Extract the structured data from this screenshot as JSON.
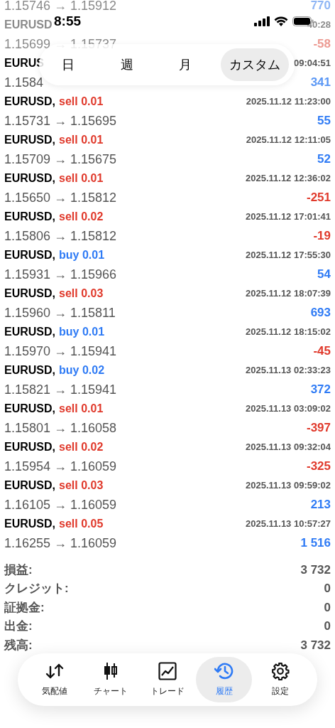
{
  "status_bar": {
    "time": "8:55"
  },
  "period_tabs": [
    {
      "label": "日",
      "selected": false
    },
    {
      "label": "週",
      "selected": false
    },
    {
      "label": "月",
      "selected": false
    },
    {
      "label": "カスタム",
      "selected": true
    }
  ],
  "trades": [
    {
      "faded": true,
      "prices": "1.15746 → 1.15912",
      "profit": {
        "text": "770",
        "color": "#8fb6f5"
      }
    },
    {
      "faded": true,
      "symbol": "EURUSD",
      "time": "40:28",
      "prices": "1.15699 → 1.15737",
      "profit": {
        "text": "-58",
        "color": "#ec9a92"
      }
    },
    {
      "faded": false,
      "symbol": "EURUS",
      "time": "09:04:51",
      "prices": "1.1584",
      "profit": {
        "text": "341",
        "color": "#5a97f5"
      }
    },
    {
      "symbol": "EURUSD,",
      "order": {
        "text": "sell 0.01",
        "color": "#e0392b"
      },
      "time": "2025.11.12 11:23:00",
      "prices": "1.15731 → 1.15695",
      "profit": {
        "text": "55",
        "color": "#2f7bf5"
      }
    },
    {
      "symbol": "EURUSD,",
      "order": {
        "text": "sell 0.01",
        "color": "#e0392b"
      },
      "time": "2025.11.12 12:11:05",
      "prices": "1.15709 → 1.15675",
      "profit": {
        "text": "52",
        "color": "#2f7bf5"
      }
    },
    {
      "symbol": "EURUSD,",
      "order": {
        "text": "sell 0.01",
        "color": "#e0392b"
      },
      "time": "2025.11.12 12:36:02",
      "prices": "1.15650 → 1.15812",
      "profit": {
        "text": "-251",
        "color": "#e0392b"
      }
    },
    {
      "symbol": "EURUSD,",
      "order": {
        "text": "sell 0.02",
        "color": "#e0392b"
      },
      "time": "2025.11.12 17:01:41",
      "prices": "1.15806 → 1.15812",
      "profit": {
        "text": "-19",
        "color": "#e0392b"
      }
    },
    {
      "symbol": "EURUSD,",
      "order": {
        "text": "buy 0.01",
        "color": "#2f7bf5"
      },
      "time": "2025.11.12 17:55:30",
      "prices": "1.15931 → 1.15966",
      "profit": {
        "text": "54",
        "color": "#2f7bf5"
      }
    },
    {
      "symbol": "EURUSD,",
      "order": {
        "text": "sell 0.03",
        "color": "#e0392b"
      },
      "time": "2025.11.12 18:07:39",
      "prices": "1.15960 → 1.15811",
      "profit": {
        "text": "693",
        "color": "#2f7bf5"
      }
    },
    {
      "symbol": "EURUSD,",
      "order": {
        "text": "buy 0.01",
        "color": "#2f7bf5"
      },
      "time": "2025.11.12 18:15:02",
      "prices": "1.15970 → 1.15941",
      "profit": {
        "text": "-45",
        "color": "#e0392b"
      }
    },
    {
      "symbol": "EURUSD,",
      "order": {
        "text": "buy 0.02",
        "color": "#2f7bf5"
      },
      "time": "2025.11.13 02:33:23",
      "prices": "1.15821 → 1.15941",
      "profit": {
        "text": "372",
        "color": "#2f7bf5"
      }
    },
    {
      "symbol": "EURUSD,",
      "order": {
        "text": "sell 0.01",
        "color": "#e0392b"
      },
      "time": "2025.11.13 03:09:02",
      "prices": "1.15801 → 1.16058",
      "profit": {
        "text": "-397",
        "color": "#e0392b"
      }
    },
    {
      "symbol": "EURUSD,",
      "order": {
        "text": "sell 0.02",
        "color": "#e0392b"
      },
      "time": "2025.11.13 09:32:04",
      "prices": "1.15954 → 1.16059",
      "profit": {
        "text": "-325",
        "color": "#e0392b"
      }
    },
    {
      "symbol": "EURUSD,",
      "order": {
        "text": "sell 0.03",
        "color": "#e0392b"
      },
      "time": "2025.11.13 09:59:02",
      "prices": "1.16105 → 1.16059",
      "profit": {
        "text": "213",
        "color": "#2f7bf5"
      }
    },
    {
      "symbol": "EURUSD,",
      "order": {
        "text": "sell 0.05",
        "color": "#e0392b"
      },
      "time": "2025.11.13 10:57:27",
      "prices": "1.16255 → 1.16059",
      "profit": {
        "text": "1 516",
        "color": "#2f7bf5"
      }
    }
  ],
  "summary": [
    {
      "label": "損益:",
      "value": "3 732"
    },
    {
      "label": "クレジット:",
      "value": "0"
    },
    {
      "label": "証拠金:",
      "value": "0"
    },
    {
      "label": "出金:",
      "value": "0"
    },
    {
      "label": "残高:",
      "value": "3 732"
    }
  ],
  "nav": [
    {
      "label": "気配値",
      "selected": false
    },
    {
      "label": "チャート",
      "selected": false
    },
    {
      "label": "トレード",
      "selected": false
    },
    {
      "label": "履歴",
      "selected": true
    },
    {
      "label": "設定",
      "selected": false
    }
  ]
}
